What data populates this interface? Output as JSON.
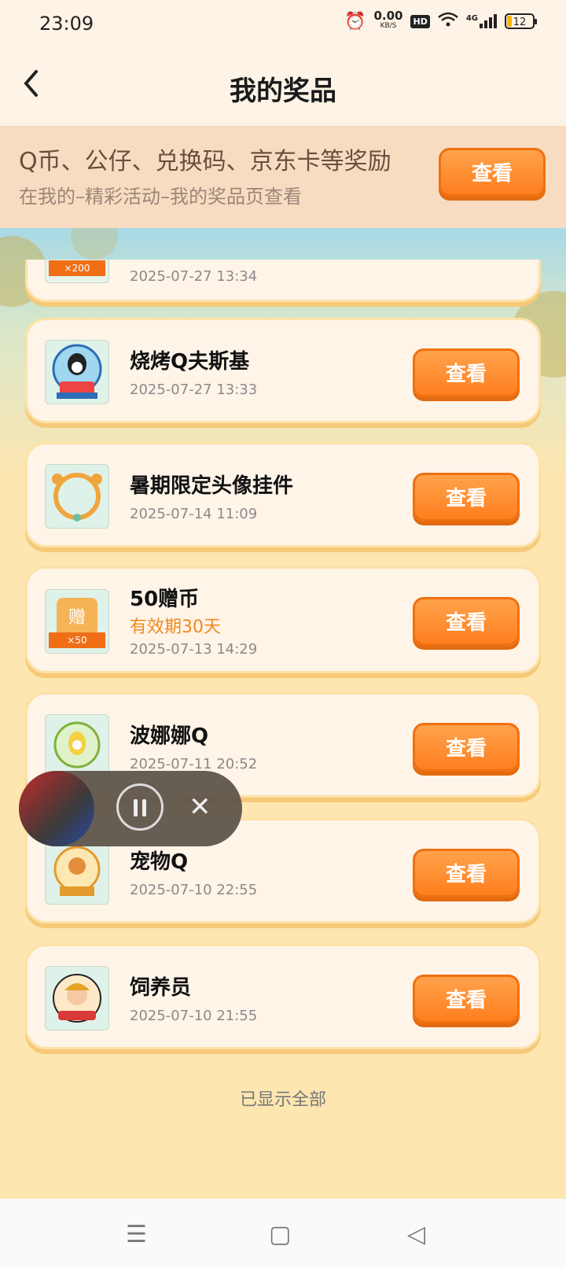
{
  "status": {
    "time": "23:09",
    "speed": "0.00",
    "speed_unit": "KB/S",
    "hd": "HD",
    "net": "4G",
    "battery": "12"
  },
  "header": {
    "title": "我的奖品",
    "back_icon": "chevron-left-icon"
  },
  "banner": {
    "line1": "Q币、公仔、兑换码、京东卡等奖励",
    "line2": "在我的–精彩活动–我的奖品页查看",
    "button": "查看"
  },
  "prizes": [
    {
      "name": "",
      "badge": "×200",
      "date": "2025-07-27 13:34",
      "button": ""
    },
    {
      "name": "烧烤Q夫斯基",
      "date": "2025-07-27 13:33",
      "button": "查看"
    },
    {
      "name": "暑期限定头像挂件",
      "date": "2025-07-14 11:09",
      "button": "查看"
    },
    {
      "name": "50赠币",
      "validity": "有效期30天",
      "badge": "×50",
      "date": "2025-07-13 14:29",
      "button": "查看"
    },
    {
      "name": "波娜娜Q",
      "date": "2025-07-11 20:52",
      "button": "查看"
    },
    {
      "name": "宠物Q",
      "date": "2025-07-10 22:55",
      "button": "查看"
    },
    {
      "name": "饲养员",
      "date": "2025-07-10 21:55",
      "button": "查看"
    }
  ],
  "footer": {
    "all_shown": "已显示全部"
  },
  "player": {
    "pause_icon": "pause-icon",
    "close_icon": "close-icon"
  },
  "nav": {
    "menu": "☰",
    "home": "▢",
    "back": "◁"
  }
}
